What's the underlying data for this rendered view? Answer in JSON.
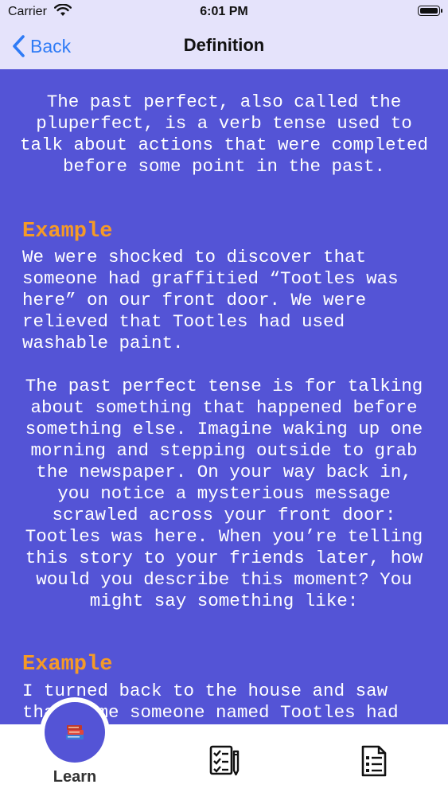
{
  "status_bar": {
    "carrier": "Carrier",
    "time": "6:01 PM"
  },
  "nav": {
    "back_label": "Back",
    "title": "Definition"
  },
  "content": {
    "intro": "The past perfect, also called the pluperfect, is a verb tense used to talk about actions that were completed before some point in the past.",
    "example1_heading": "Example",
    "example1_text": "We were shocked to discover that someone had graffitied “Tootles was here” on our front door. We were relieved that Tootles had used washable paint.",
    "explanation": "The past perfect tense is for talking about something that happened before something else. Imagine waking up one morning and stepping outside to grab the newspaper. On your way back in, you notice a mysterious message scrawled across your front door: Tootles was here. When you’re telling this story to your friends later, how would you describe this moment? You might say something like:",
    "example2_heading": "Example",
    "example2_text": "I turned back to the house and saw that some someone named Tootles had"
  },
  "tabbar": {
    "learn_label": "Learn",
    "tabs": [
      "learn",
      "quiz",
      "notes"
    ]
  },
  "colors": {
    "background": "#5454d6",
    "nav_background": "#e5e3fb",
    "accent_link": "#2f7bf6",
    "heading": "#f59a27"
  }
}
